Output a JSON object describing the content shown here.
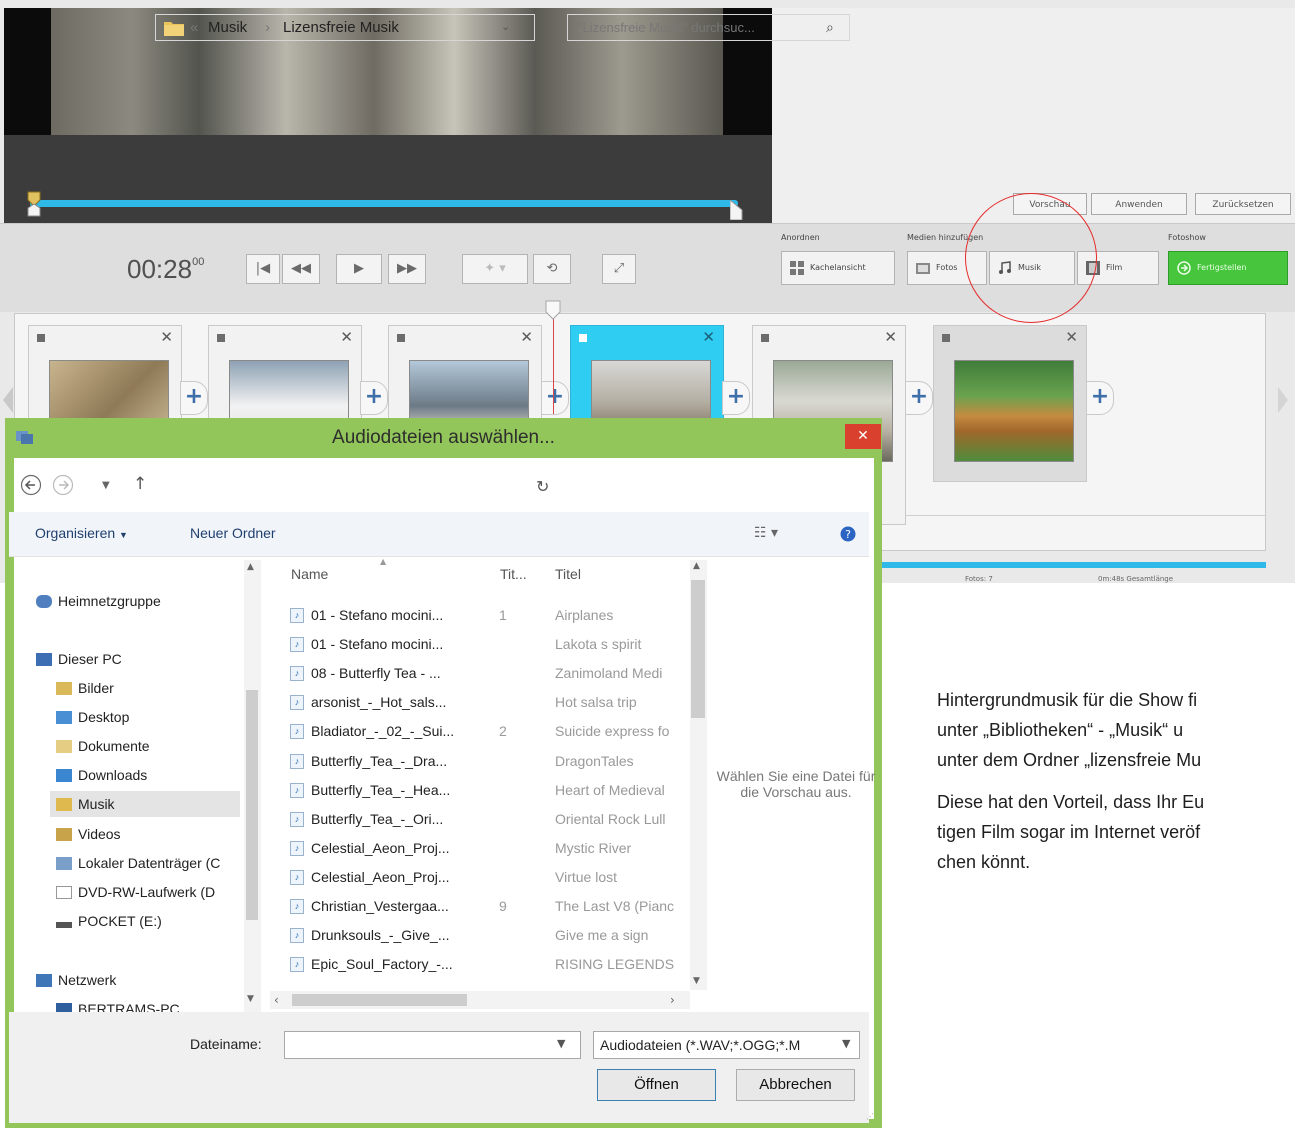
{
  "player": {
    "time": "00:28",
    "time_frames": "00",
    "buttons": [
      "Vorschau",
      "Anwenden",
      "Zurücksetzen"
    ]
  },
  "toolbar": {
    "group_anordnen": "Anordnen",
    "group_medien": "Medien hinzufügen",
    "group_fotoshow": "Fotoshow",
    "btn_kachel": "Kachelansicht",
    "btn_fotos": "Fotos",
    "btn_musik": "Musik",
    "btn_film": "Film",
    "btn_fertig": "Fertigstellen"
  },
  "timeline": {
    "status_fotos": "Fotos: 7",
    "status_length": "0m:48s Gesamtlänge"
  },
  "dialog": {
    "title": "Audiodateien auswählen...",
    "close": "✕",
    "address": {
      "prefix": "«",
      "crumb1": "Musik",
      "sep": "›",
      "crumb2": "Lizensfreie Musik"
    },
    "search_placeholder": "\"Lizensfreie Musik\" durchsuc...",
    "commands": {
      "organize": "Organisieren",
      "new_folder": "Neuer Ordner"
    },
    "nav": [
      {
        "label": "Heimnetzgruppe"
      },
      {
        "label": "Dieser PC"
      },
      {
        "label": "Bilder"
      },
      {
        "label": "Desktop"
      },
      {
        "label": "Dokumente"
      },
      {
        "label": "Downloads"
      },
      {
        "label": "Musik"
      },
      {
        "label": "Videos"
      },
      {
        "label": "Lokaler Datenträger (C"
      },
      {
        "label": "DVD-RW-Laufwerk (D"
      },
      {
        "label": "POCKET (E:)"
      },
      {
        "label": "Netzwerk"
      },
      {
        "label": "BERTRAMS-PC"
      }
    ],
    "columns": {
      "name": "Name",
      "track": "Tit...",
      "title": "Titel"
    },
    "files": [
      {
        "name": "01 - Stefano mocini...",
        "track": "1",
        "title": "Airplanes"
      },
      {
        "name": "01 - Stefano mocini...",
        "track": "",
        "title": "Lakota s spirit"
      },
      {
        "name": "08 - Butterfly Tea - ...",
        "track": "",
        "title": "Zanimoland Medi"
      },
      {
        "name": "arsonist_-_Hot_sals...",
        "track": "",
        "title": "Hot salsa trip"
      },
      {
        "name": "Bladiator_-_02_-_Sui...",
        "track": "2",
        "title": "Suicide express fo"
      },
      {
        "name": "Butterfly_Tea_-_Dra...",
        "track": "",
        "title": "DragonTales"
      },
      {
        "name": "Butterfly_Tea_-_Hea...",
        "track": "",
        "title": "Heart of Medieval"
      },
      {
        "name": "Butterfly_Tea_-_Ori...",
        "track": "",
        "title": "Oriental Rock Lull"
      },
      {
        "name": "Celestial_Aeon_Proj...",
        "track": "",
        "title": "Mystic River"
      },
      {
        "name": "Celestial_Aeon_Proj...",
        "track": "",
        "title": "Virtue lost"
      },
      {
        "name": "Christian_Vestergaa...",
        "track": "9",
        "title": "The Last V8 (Pianc"
      },
      {
        "name": "Drunksouls_-_Give_...",
        "track": "",
        "title": "Give me a sign"
      },
      {
        "name": "Epic_Soul_Factory_-...",
        "track": "",
        "title": "RISING LEGENDS"
      }
    ],
    "preview_note": "Wählen Sie eine Datei für die Vorschau aus.",
    "filename_label": "Dateiname:",
    "filename_value": "",
    "filter": "Audiodateien (*.WAV;*.OGG;*.M",
    "open": "Öffnen",
    "cancel": "Abbrechen"
  },
  "instructions": {
    "p1_l1": "Hintergrundmusik für die Show fi",
    "p1_l2": "unter „Bibliotheken“ - „Musik“ u",
    "p1_l3": "unter dem Ordner „lizensfreie Mu",
    "p2_l1": "Diese hat den Vorteil, dass Ihr Eu",
    "p2_l2": "tigen Film sogar im Internet veröf",
    "p2_l3": "chen könnt."
  },
  "colors": {
    "accent_blue": "#2fb9e8",
    "dialog_frame": "#92c65a",
    "finish_green": "#46c53d",
    "highlight_red": "#e52a2a"
  }
}
